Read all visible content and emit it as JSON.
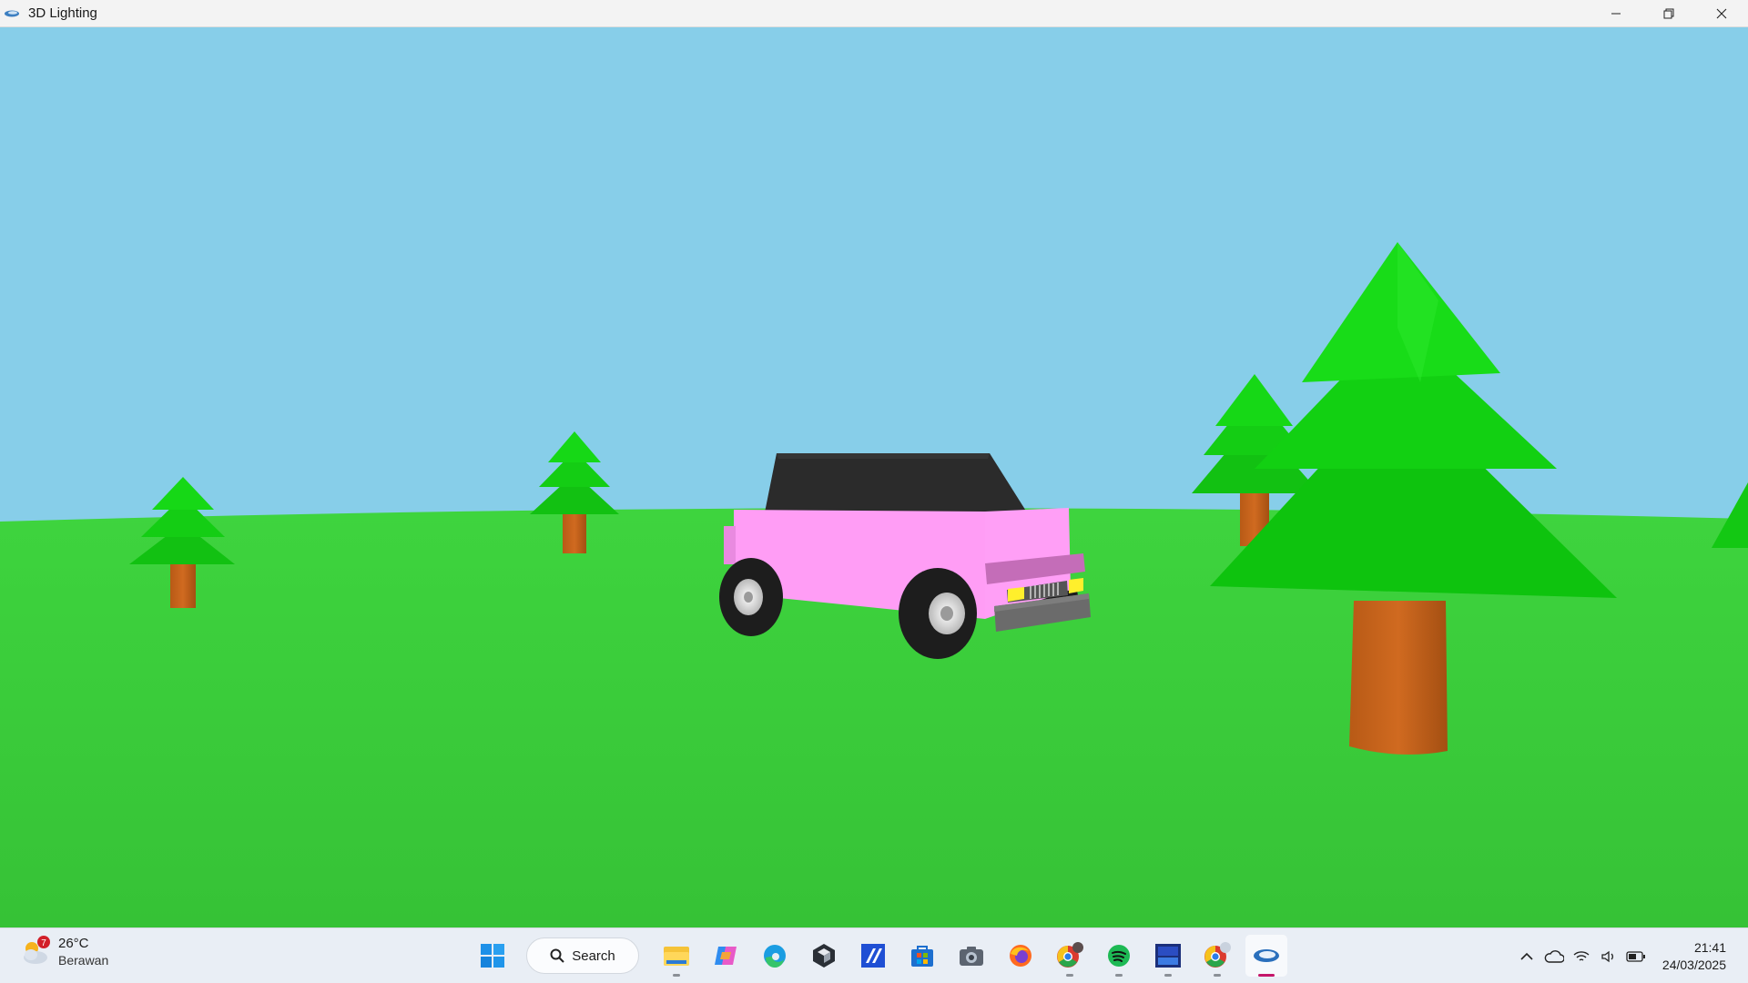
{
  "window": {
    "title": "3D Lighting",
    "controls": [
      "minimize",
      "restore",
      "close"
    ]
  },
  "scene": {
    "sky_color": "#87cee9",
    "ground_color": "#38c438",
    "car_body_color": "#ff9ff6",
    "car_roof_color": "#2a2a2a",
    "tree_foliage_color": "#13d613",
    "tree_trunk_color": "#c4621a"
  },
  "taskbar": {
    "weather": {
      "temperature": "26°C",
      "condition": "Berawan",
      "badge": "7"
    },
    "search_label": "Search",
    "apps": [
      "windows-start-icon",
      "file-explorer-icon",
      "copilot-icon",
      "edge-icon",
      "unity-icon",
      "visual-studio-icon",
      "microsoft-store-icon",
      "camera-icon",
      "firefox-icon",
      "chrome-profile-k-icon",
      "spotify-icon",
      "devcpp-icon",
      "chrome-icon",
      "opengl-app-icon"
    ],
    "tray": {
      "time": "21:41",
      "date": "24/03/2025"
    }
  }
}
